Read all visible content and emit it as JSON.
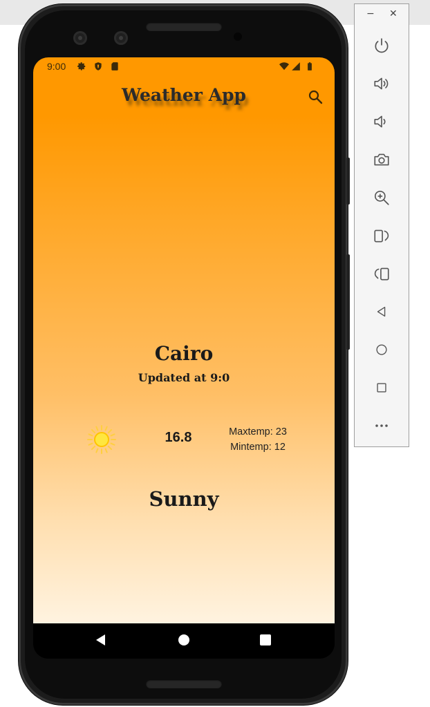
{
  "status_bar": {
    "time": "9:00",
    "icons": [
      "gear-icon",
      "shield-icon",
      "sd-card-icon",
      "wifi-icon",
      "signal-icon",
      "battery-icon"
    ]
  },
  "app_bar": {
    "title": "Weather App",
    "search_icon": "search-icon"
  },
  "weather": {
    "city": "Cairo",
    "updated": "Updated at 9:0",
    "icon": "sun-icon",
    "temp": "16.8",
    "max_temp": "Maxtemp: 23",
    "min_temp": "Mintemp: 12",
    "condition": "Sunny"
  },
  "nav_bar": {
    "buttons": [
      "back-icon",
      "home-icon",
      "recents-icon"
    ]
  },
  "emulator_panel": {
    "window_controls": {
      "minimize": "−",
      "close": "✕"
    },
    "buttons": [
      "power-icon",
      "volume-up-icon",
      "volume-down-icon",
      "camera-icon",
      "zoom-icon",
      "rotate-left-icon",
      "rotate-right-icon",
      "back-icon",
      "home-icon",
      "overview-icon",
      "more-icon"
    ]
  },
  "colors": {
    "app_bar": "#ff9800",
    "gradient_bottom": "#fff3e0",
    "sun": "#ffd600",
    "text_dark": "#1a1a1a"
  }
}
